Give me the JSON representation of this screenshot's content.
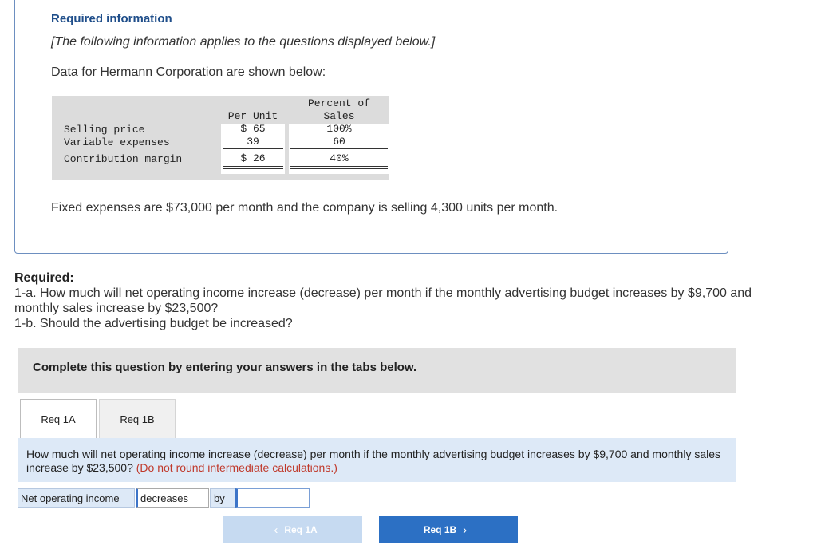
{
  "header": {
    "required_information": "Required information",
    "bracket_note": "[The following information applies to the questions displayed below.]",
    "data_intro": "Data for Hermann Corporation are shown below:"
  },
  "table": {
    "col_per_unit": "Per Unit",
    "col_percent_line1": "Percent of",
    "col_percent_line2": "Sales",
    "rows": [
      {
        "label": "Selling price",
        "per_unit": "$ 65",
        "percent": "100%"
      },
      {
        "label": "Variable expenses",
        "per_unit": "39",
        "percent": "60"
      },
      {
        "label": "Contribution margin",
        "per_unit": "$ 26",
        "percent": "40%"
      }
    ]
  },
  "fixed_expenses_text": "Fixed expenses are $73,000 per month and the company is selling 4,300 units per month.",
  "required": {
    "heading": "Required:",
    "q1a": "1-a. How much will net operating income increase (decrease) per month if the monthly advertising budget increases by $9,700 and monthly sales increase by $23,500?",
    "q1b": "1-b. Should the advertising budget be increased?"
  },
  "complete_bar": "Complete this question by entering your answers in the tabs below.",
  "tabs": {
    "tab_a": "Req 1A",
    "tab_b": "Req 1B"
  },
  "question": {
    "text": "How much will net operating income increase (decrease) per month if the monthly advertising budget increases by $9,700 and monthly sales increase by $23,500?",
    "note": "(Do not round intermediate calculations.)"
  },
  "answer": {
    "label": "Net operating income",
    "select_value": "decreases",
    "by": "by",
    "input_value": ""
  },
  "nav": {
    "prev": "Req 1A",
    "next": "Req 1B"
  },
  "colors": {
    "accent": "#1f4e8a",
    "next_button": "#2c70c4",
    "prev_button": "#c6daf1",
    "note_red": "#c0392b"
  }
}
